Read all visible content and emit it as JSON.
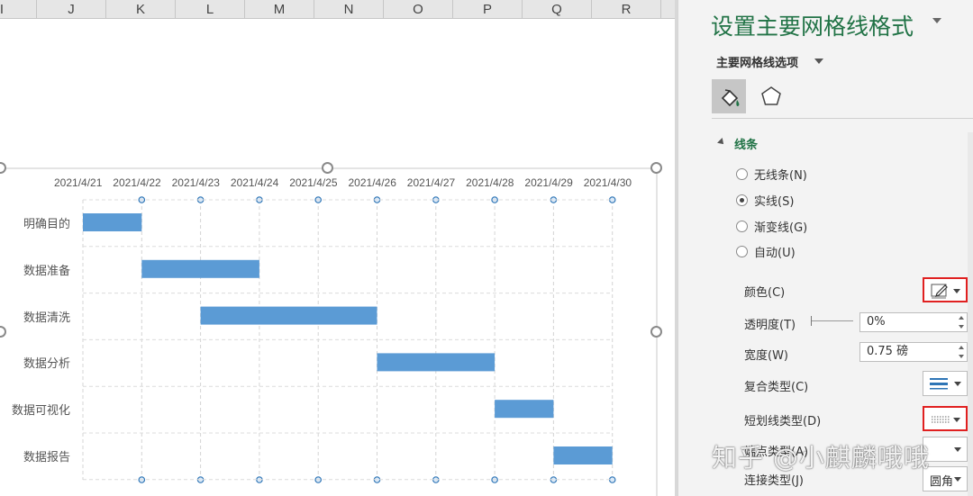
{
  "sheet": {
    "columns": [
      "I",
      "J",
      "K",
      "L",
      "M",
      "N",
      "O",
      "P",
      "Q",
      "R"
    ]
  },
  "chart_data": {
    "type": "bar",
    "orientation": "horizontal",
    "subtype": "gantt",
    "x_ticks": [
      "2021/4/21",
      "2021/4/22",
      "2021/4/23",
      "2021/4/24",
      "2021/4/25",
      "2021/4/26",
      "2021/4/27",
      "2021/4/28",
      "2021/4/29",
      "2021/4/30"
    ],
    "xlim": [
      "2021/4/21",
      "2021/4/30"
    ],
    "x_axis_position": "top",
    "categories": [
      "明确目的",
      "数据准备",
      "数据清洗",
      "数据分析",
      "数据可视化",
      "数据报告"
    ],
    "series": [
      {
        "start": [
          "2021/4/21",
          "2021/4/22",
          "2021/4/23",
          "2021/4/26",
          "2021/4/28",
          "2021/4/29"
        ],
        "end": [
          "2021/4/22",
          "2021/4/24",
          "2021/4/26",
          "2021/4/28",
          "2021/4/29",
          "2021/4/30"
        ]
      }
    ],
    "bar_color": "#5b9bd5",
    "grid": "dashed",
    "title": "",
    "xlabel": "",
    "ylabel": ""
  },
  "pane": {
    "title": "设置主要网格线格式",
    "subtitle": "主要网格线选项",
    "section_title": "线条",
    "line_options": [
      {
        "label": "无线条(N)",
        "selected": false
      },
      {
        "label": "实线(S)",
        "selected": true
      },
      {
        "label": "渐变线(G)",
        "selected": false
      },
      {
        "label": "自动(U)",
        "selected": false
      }
    ],
    "color_label": "颜色(C)",
    "transparency_label": "透明度(T)",
    "transparency_value": "0%",
    "width_label": "宽度(W)",
    "width_value": "0.75 磅",
    "compound_label": "复合类型(C)",
    "dash_label": "短划线类型(D)",
    "cap_label": "端点类型(A)",
    "join_label": "连接类型(J)",
    "join_value": "圆角",
    "highlight_color": "#e02020",
    "icons": [
      "paint-bucket-icon",
      "pentagon-icon",
      "pen-icon",
      "lines-icon",
      "dash-icon"
    ]
  },
  "watermark": "知乎 @小麒麟哦哦"
}
